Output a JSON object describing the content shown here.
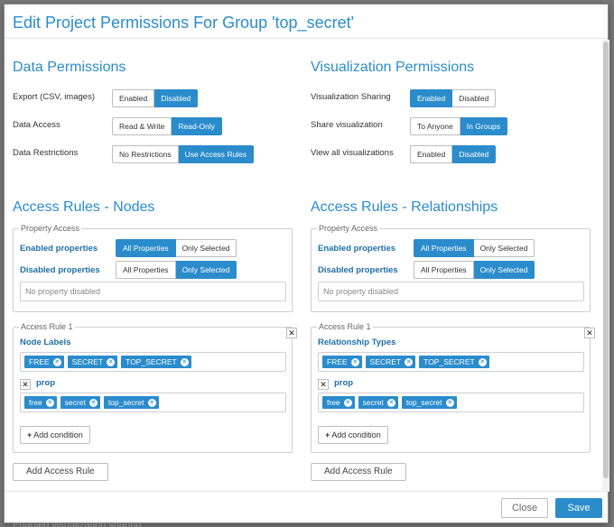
{
  "backdrop_text": "Enabled visualization sharing",
  "modal": {
    "title": "Edit Project Permissions For Group 'top_secret'",
    "close_label": "Close",
    "save_label": "Save"
  },
  "data_permissions": {
    "title": "Data Permissions",
    "rows": [
      {
        "label": "Export (CSV, images)",
        "options": [
          "Enabled",
          "Disabled"
        ],
        "selected": "Disabled"
      },
      {
        "label": "Data Access",
        "options": [
          "Read & Write",
          "Read-Only"
        ],
        "selected": "Read-Only"
      },
      {
        "label": "Data Restrictions",
        "options": [
          "No Restrictions",
          "Use Access Rules"
        ],
        "selected": "Use Access Rules"
      }
    ]
  },
  "visualization_permissions": {
    "title": "Visualization Permissions",
    "rows": [
      {
        "label": "Visualization Sharing",
        "options": [
          "Enabled",
          "Disabled"
        ],
        "selected": "Enabled"
      },
      {
        "label": "Share visualization",
        "options": [
          "To Anyone",
          "In Groups"
        ],
        "selected": "In Groups"
      },
      {
        "label": "View all visualizations",
        "options": [
          "Enabled",
          "Disabled"
        ],
        "selected": "Disabled"
      }
    ]
  },
  "nodes": {
    "title": "Access Rules - Nodes",
    "property_access": {
      "legend": "Property Access",
      "enabled_label": "Enabled properties",
      "enabled_options": [
        "All Properties",
        "Only Selected"
      ],
      "enabled_selected": "All Properties",
      "disabled_label": "Disabled properties",
      "disabled_options": [
        "All Properties",
        "Only Selected"
      ],
      "disabled_selected": "Only Selected",
      "empty_text": "No property disabled"
    },
    "rule": {
      "legend": "Access Rule 1",
      "types_label": "Node Labels",
      "types": [
        "FREE",
        "SECRET",
        "TOP_SECRET"
      ],
      "prop_label": "prop",
      "prop_values": [
        "free",
        "secret",
        "top_secret"
      ],
      "add_condition": "Add condition"
    },
    "add_rule": "Add Access Rule"
  },
  "relationships": {
    "title": "Access Rules - Relationships",
    "property_access": {
      "legend": "Property Access",
      "enabled_label": "Enabled properties",
      "enabled_options": [
        "All Properties",
        "Only Selected"
      ],
      "enabled_selected": "All Properties",
      "disabled_label": "Disabled properties",
      "disabled_options": [
        "All Properties",
        "Only Selected"
      ],
      "disabled_selected": "Only Selected",
      "empty_text": "No property disabled"
    },
    "rule": {
      "legend": "Access Rule 1",
      "types_label": "Relationship Types",
      "types": [
        "FREE",
        "SECRET",
        "TOP_SECRET"
      ],
      "prop_label": "prop",
      "prop_values": [
        "free",
        "secret",
        "top_secret"
      ],
      "add_condition": "Add condition"
    },
    "add_rule": "Add Access Rule"
  },
  "colors": {
    "accent": "#2b8ccc",
    "border": "#bdbdbd"
  },
  "icons": {
    "remove_tag": "x-circle-icon",
    "close_rule": "close-icon",
    "remove_condition": "close-icon",
    "add": "plus-icon"
  }
}
